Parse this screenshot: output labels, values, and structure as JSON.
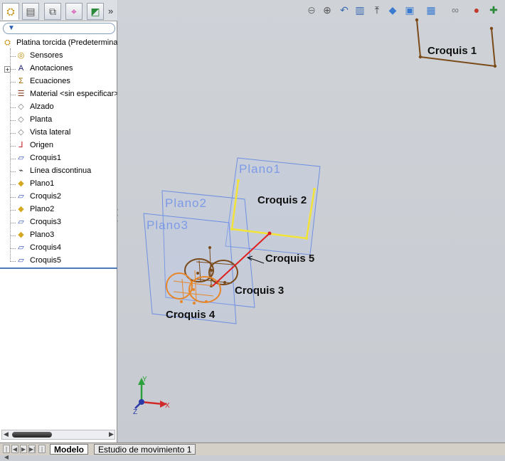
{
  "feature_tree": {
    "root": "Platina torcida  (Predetermina",
    "items": [
      {
        "label": "Sensores",
        "icon": "sensor-icon"
      },
      {
        "label": "Anotaciones",
        "icon": "annotation-icon"
      },
      {
        "label": "Ecuaciones",
        "icon": "equation-icon"
      },
      {
        "label": "Material <sin especificar>",
        "icon": "material-icon"
      },
      {
        "label": "Alzado",
        "icon": "plane-icon"
      },
      {
        "label": "Planta",
        "icon": "plane-icon"
      },
      {
        "label": "Vista lateral",
        "icon": "plane-icon"
      },
      {
        "label": "Origen",
        "icon": "origin-icon"
      },
      {
        "label": "Croquis1",
        "icon": "sketch-icon"
      },
      {
        "label": "Línea discontinua",
        "icon": "3d-sketch-icon"
      },
      {
        "label": "Plano1",
        "icon": "plane-feature-icon"
      },
      {
        "label": "Croquis2",
        "icon": "sketch-icon"
      },
      {
        "label": "Plano2",
        "icon": "plane-feature-icon"
      },
      {
        "label": "Croquis3",
        "icon": "sketch-icon"
      },
      {
        "label": "Plano3",
        "icon": "plane-feature-icon"
      },
      {
        "label": "Croquis4",
        "icon": "sketch-icon"
      },
      {
        "label": "Croquis5",
        "icon": "sketch-icon"
      }
    ]
  },
  "panel_tabs": [
    "featuremanager-icon",
    "propertymanager-icon",
    "configurationmanager-icon",
    "dimxpert-icon",
    "display-manager-icon"
  ],
  "bottom_tabs": {
    "model": "Modelo",
    "motion_study": "Estudio de movimiento 1"
  },
  "viewport": {
    "labels": {
      "croquis1": "Croquis 1",
      "croquis2": "Croquis 2",
      "croquis3": "Croquis 3",
      "croquis4": "Croquis 4",
      "croquis5": "Croquis 5",
      "plano1": "Plano1",
      "plano2": "Plano2",
      "plano3": "Plano3"
    },
    "axes": {
      "x": "X",
      "y": "Y",
      "z": "Z"
    }
  },
  "colors": {
    "viewport_bg": "#cbcfd5",
    "plane_stroke": "#6f8fe0",
    "plane_fill": "#b8c8ec",
    "croquis1": "#7a4a1a",
    "croquis2": "#f2e33a",
    "croquis3": "#7a4a1a",
    "croquis4": "#e8862a",
    "croquis5": "#e02020"
  }
}
